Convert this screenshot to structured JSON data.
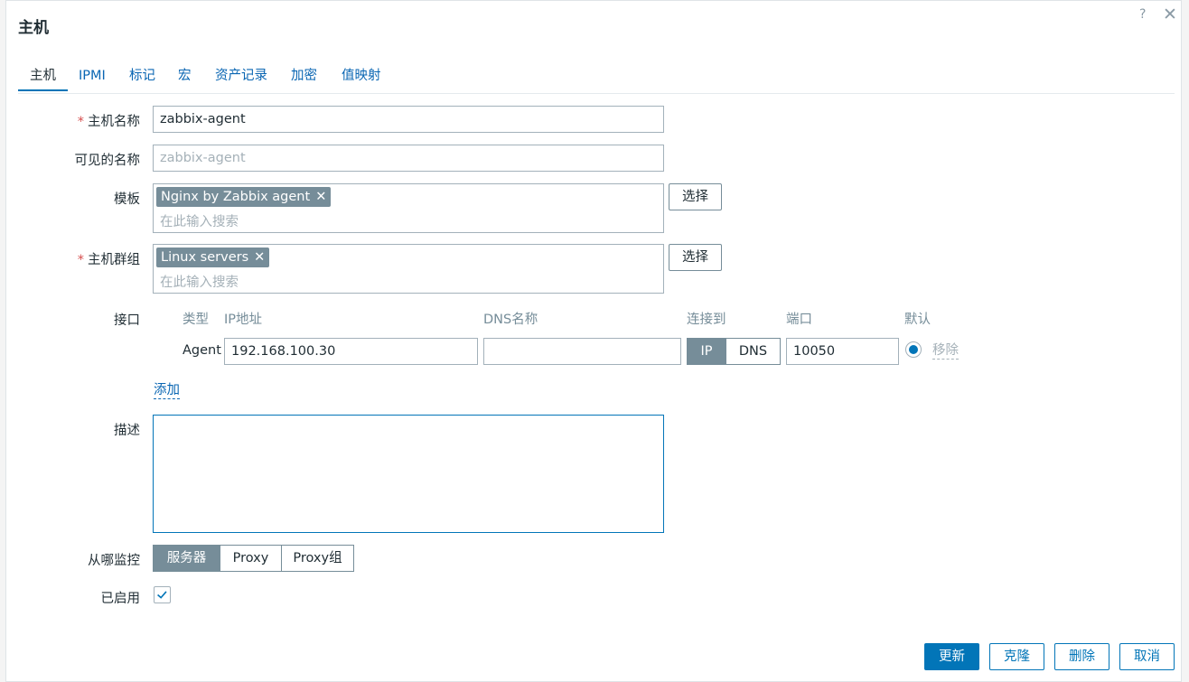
{
  "dialog": {
    "title": "主机",
    "help": "?",
    "close": "✕"
  },
  "tabs": [
    {
      "label": "主机",
      "active": true
    },
    {
      "label": "IPMI"
    },
    {
      "label": "标记"
    },
    {
      "label": "宏"
    },
    {
      "label": "资产记录"
    },
    {
      "label": "加密"
    },
    {
      "label": "值映射"
    }
  ],
  "form": {
    "host_name": {
      "label": "主机名称",
      "value": "zabbix-agent",
      "required": true
    },
    "visible_name": {
      "label": "可见的名称",
      "placeholder": "zabbix-agent"
    },
    "templates": {
      "label": "模板",
      "chips": [
        "Nginx by Zabbix agent"
      ],
      "placeholder": "在此输入搜索",
      "select_label": "选择"
    },
    "host_groups": {
      "label": "主机群组",
      "chips": [
        "Linux servers"
      ],
      "placeholder": "在此输入搜索",
      "select_label": "选择",
      "required": true
    },
    "interfaces": {
      "label": "接口",
      "columns": {
        "type": "类型",
        "ip": "IP地址",
        "dns": "DNS名称",
        "connect_to": "连接到",
        "port": "端口",
        "default": "默认"
      },
      "rows": [
        {
          "type": "Agent",
          "ip": "192.168.100.30",
          "dns": "",
          "connect_options": [
            "IP",
            "DNS"
          ],
          "connect_selected": "IP",
          "port": "10050",
          "default": true,
          "remove_label": "移除"
        }
      ],
      "add_label": "添加"
    },
    "description": {
      "label": "描述",
      "value": ""
    },
    "monitored_by": {
      "label": "从哪监控",
      "options": [
        "服务器",
        "Proxy",
        "Proxy组"
      ],
      "selected": "服务器"
    },
    "enabled": {
      "label": "已启用",
      "checked": true
    }
  },
  "footer": {
    "update": "更新",
    "clone": "克隆",
    "delete": "删除",
    "cancel": "取消"
  },
  "colors": {
    "accent": "#0275b8",
    "chip": "#768d99",
    "required": "#d64e4e"
  }
}
